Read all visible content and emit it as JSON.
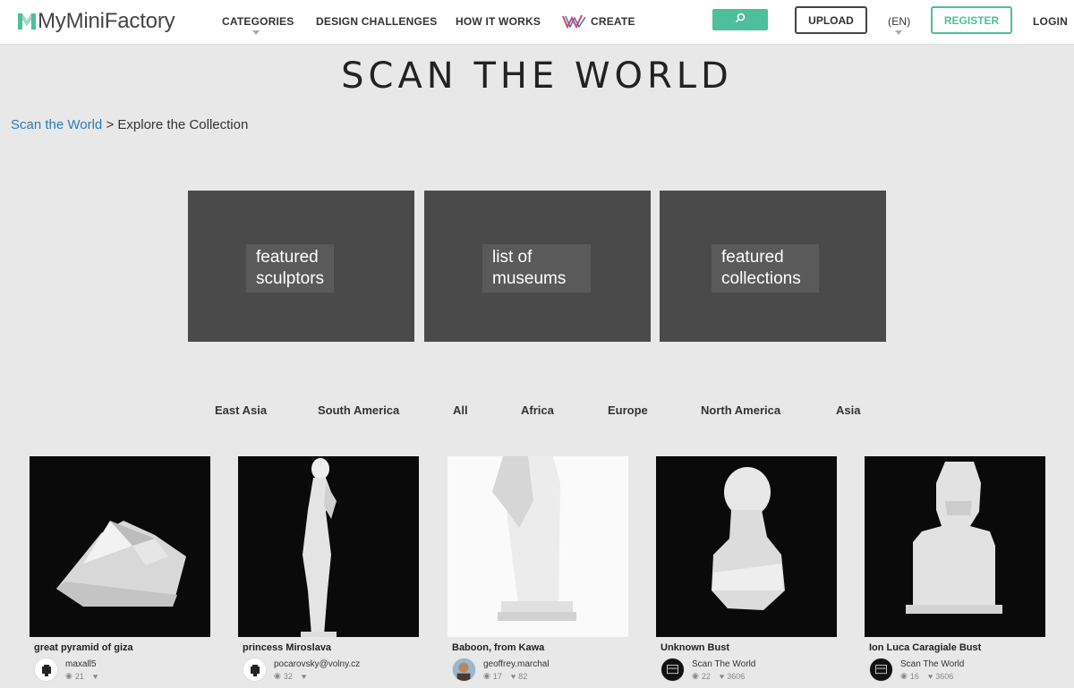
{
  "header": {
    "logo_text": "MyMiniFactory",
    "nav": {
      "categories": "CATEGORIES",
      "design_challenges": "DESIGN CHALLENGES",
      "how_it_works": "HOW IT WORKS",
      "create": "CREATE"
    },
    "upload_label": "UPLOAD",
    "language": "(EN)",
    "register_label": "REGISTER",
    "login_label": "LOGIN"
  },
  "page_title": "SCAN THE WORLD",
  "breadcrumb": {
    "link": "Scan the World",
    "separator": " > ",
    "current": "Explore the Collection"
  },
  "tiles": [
    {
      "line1": "featured",
      "line2": "sculptors"
    },
    {
      "line1": "list of",
      "line2": "museums"
    },
    {
      "line1": "featured",
      "line2": "collections"
    }
  ],
  "regions": [
    "East Asia",
    "South America",
    "All",
    "Africa",
    "Europe",
    "North America",
    "Asia"
  ],
  "cards": [
    {
      "title": "great pyramid of giza",
      "user": "maxall5",
      "views": "21",
      "likes": ""
    },
    {
      "title": "princess Miroslava",
      "user": "pocarovsky@volny.cz",
      "views": "32",
      "likes": ""
    },
    {
      "title": "Baboon, from Kawa",
      "user": "geoffrey.marchal",
      "views": "17",
      "likes": "82"
    },
    {
      "title": "Unknown Bust",
      "user": "Scan The World",
      "views": "22",
      "likes": "3606"
    },
    {
      "title": "Ion Luca Caragiale Bust",
      "user": "Scan The World",
      "views": "16",
      "likes": "3606"
    }
  ],
  "colors": {
    "accent_green": "#4dbf9a",
    "link_blue": "#2a7bbf",
    "tile_bg": "#4a4a4a",
    "page_bg": "#e8e8e8"
  },
  "icons": {
    "search": "search-icon",
    "create": "create-logo-icon",
    "views": "eye-icon",
    "likes": "heart-icon"
  }
}
